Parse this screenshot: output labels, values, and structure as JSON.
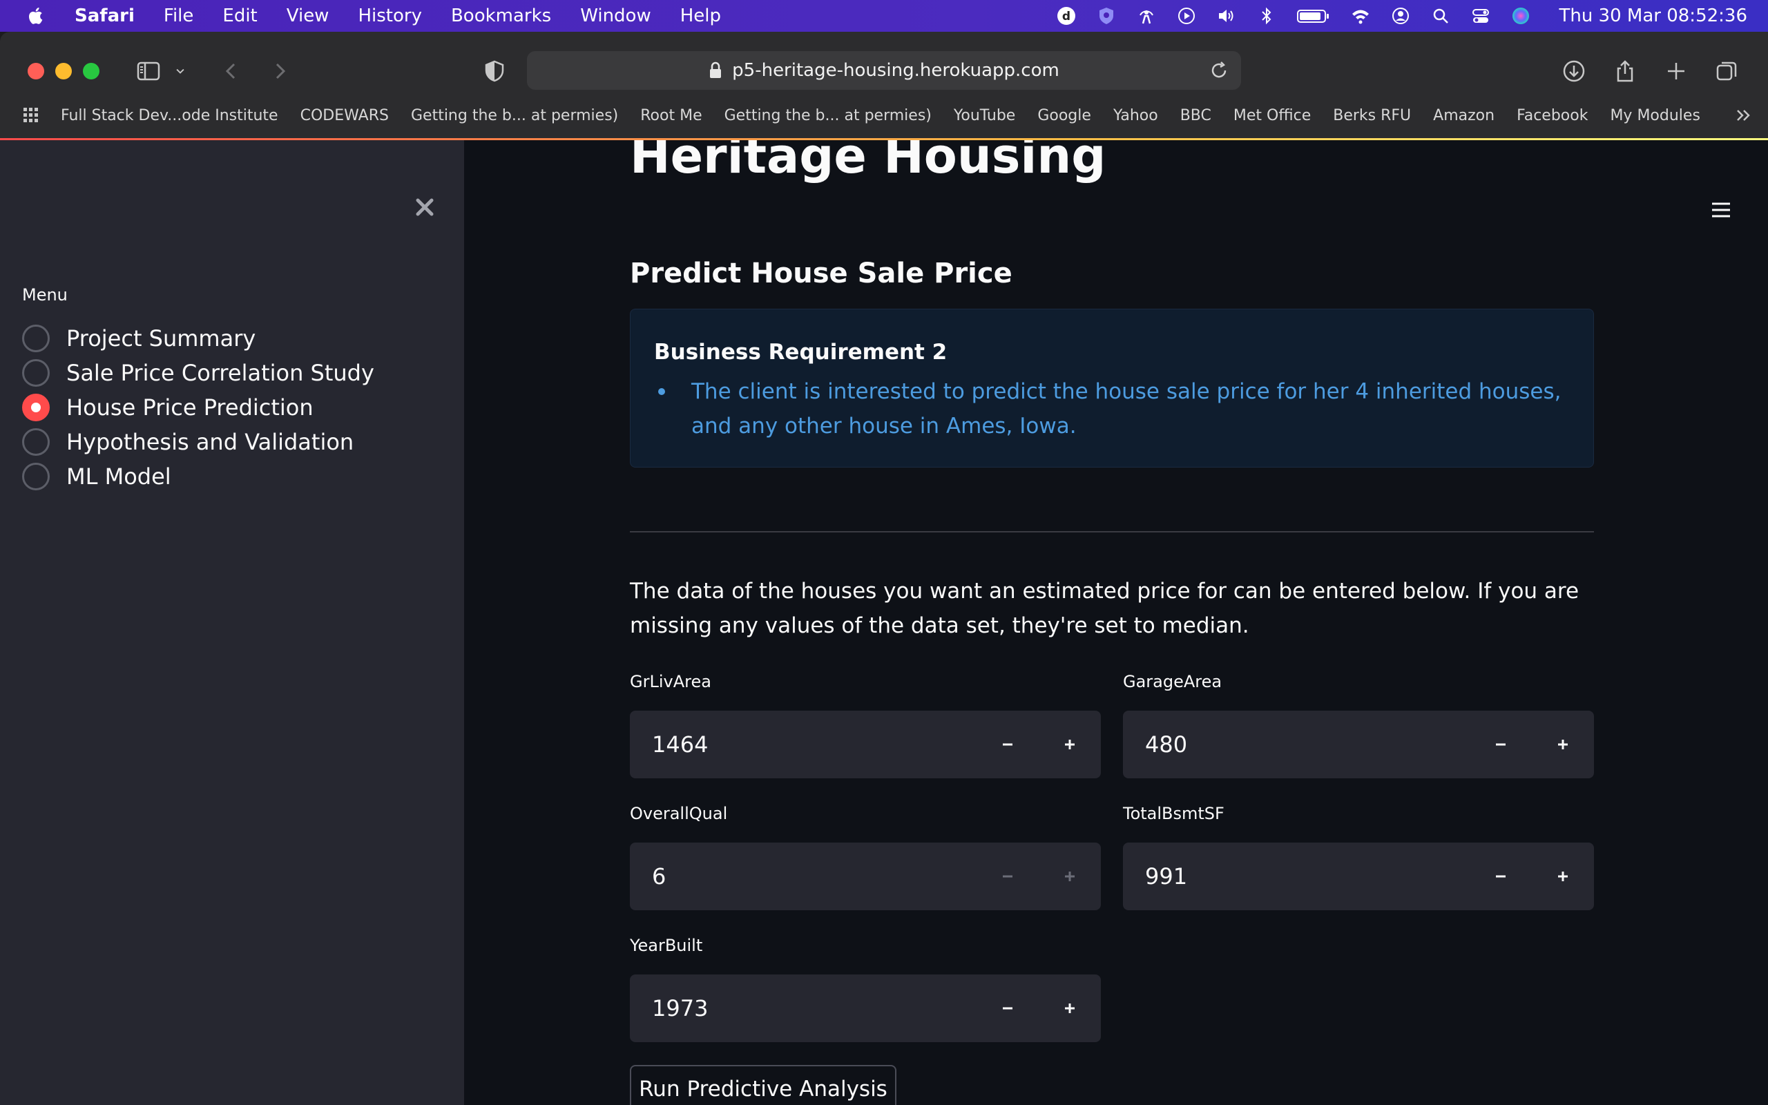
{
  "menubar": {
    "app": "Safari",
    "items": [
      "File",
      "Edit",
      "View",
      "History",
      "Bookmarks",
      "Window",
      "Help"
    ],
    "clock": "Thu 30 Mar  08:52:36",
    "tray_icons": [
      "d-app-icon",
      "shield-app-icon",
      "person-app-icon",
      "play-icon",
      "volume-icon",
      "bluetooth-icon",
      "battery-icon",
      "wifi-icon",
      "user-icon",
      "search-icon",
      "control-center-icon",
      "siri-icon"
    ]
  },
  "browser": {
    "url": "p5-heritage-housing.herokuapp.com",
    "bookmarks": [
      "Full Stack Dev...ode Institute",
      "CODEWARS",
      "Getting the b... at permies)",
      "Root Me",
      "Getting the b... at permies)",
      "YouTube",
      "Google",
      "Yahoo",
      "BBC",
      "Met Office",
      "Berks RFU",
      "Amazon",
      "Facebook",
      "My Modules"
    ]
  },
  "sidebar": {
    "menu_label": "Menu",
    "items": [
      {
        "label": "Project Summary",
        "checked": false
      },
      {
        "label": "Sale Price Correlation Study",
        "checked": false
      },
      {
        "label": "House Price Prediction",
        "checked": true
      },
      {
        "label": "Hypothesis and Validation",
        "checked": false
      },
      {
        "label": "ML Model",
        "checked": false
      }
    ]
  },
  "main": {
    "title": "Heritage Housing",
    "subheader": "Predict House Sale Price",
    "info": {
      "title": "Business Requirement 2",
      "bullet": "The client is interested to predict the house sale price for her 4 inherited houses, and any other house in Ames, Iowa."
    },
    "intro": "The data of the houses you want an estimated price for can be entered below. If you are missing any values of the data set, they're set to median.",
    "fields": {
      "grlivarea": {
        "label": "GrLivArea",
        "value": "1464"
      },
      "garagearea": {
        "label": "GarageArea",
        "value": "480"
      },
      "overallqual": {
        "label": "OverallQual",
        "value": "6"
      },
      "totalbsmtsf": {
        "label": "TotalBsmtSF",
        "value": "991"
      },
      "yearbuilt": {
        "label": "YearBuilt",
        "value": "1973"
      }
    },
    "run_button": "Run Predictive Analysis"
  }
}
